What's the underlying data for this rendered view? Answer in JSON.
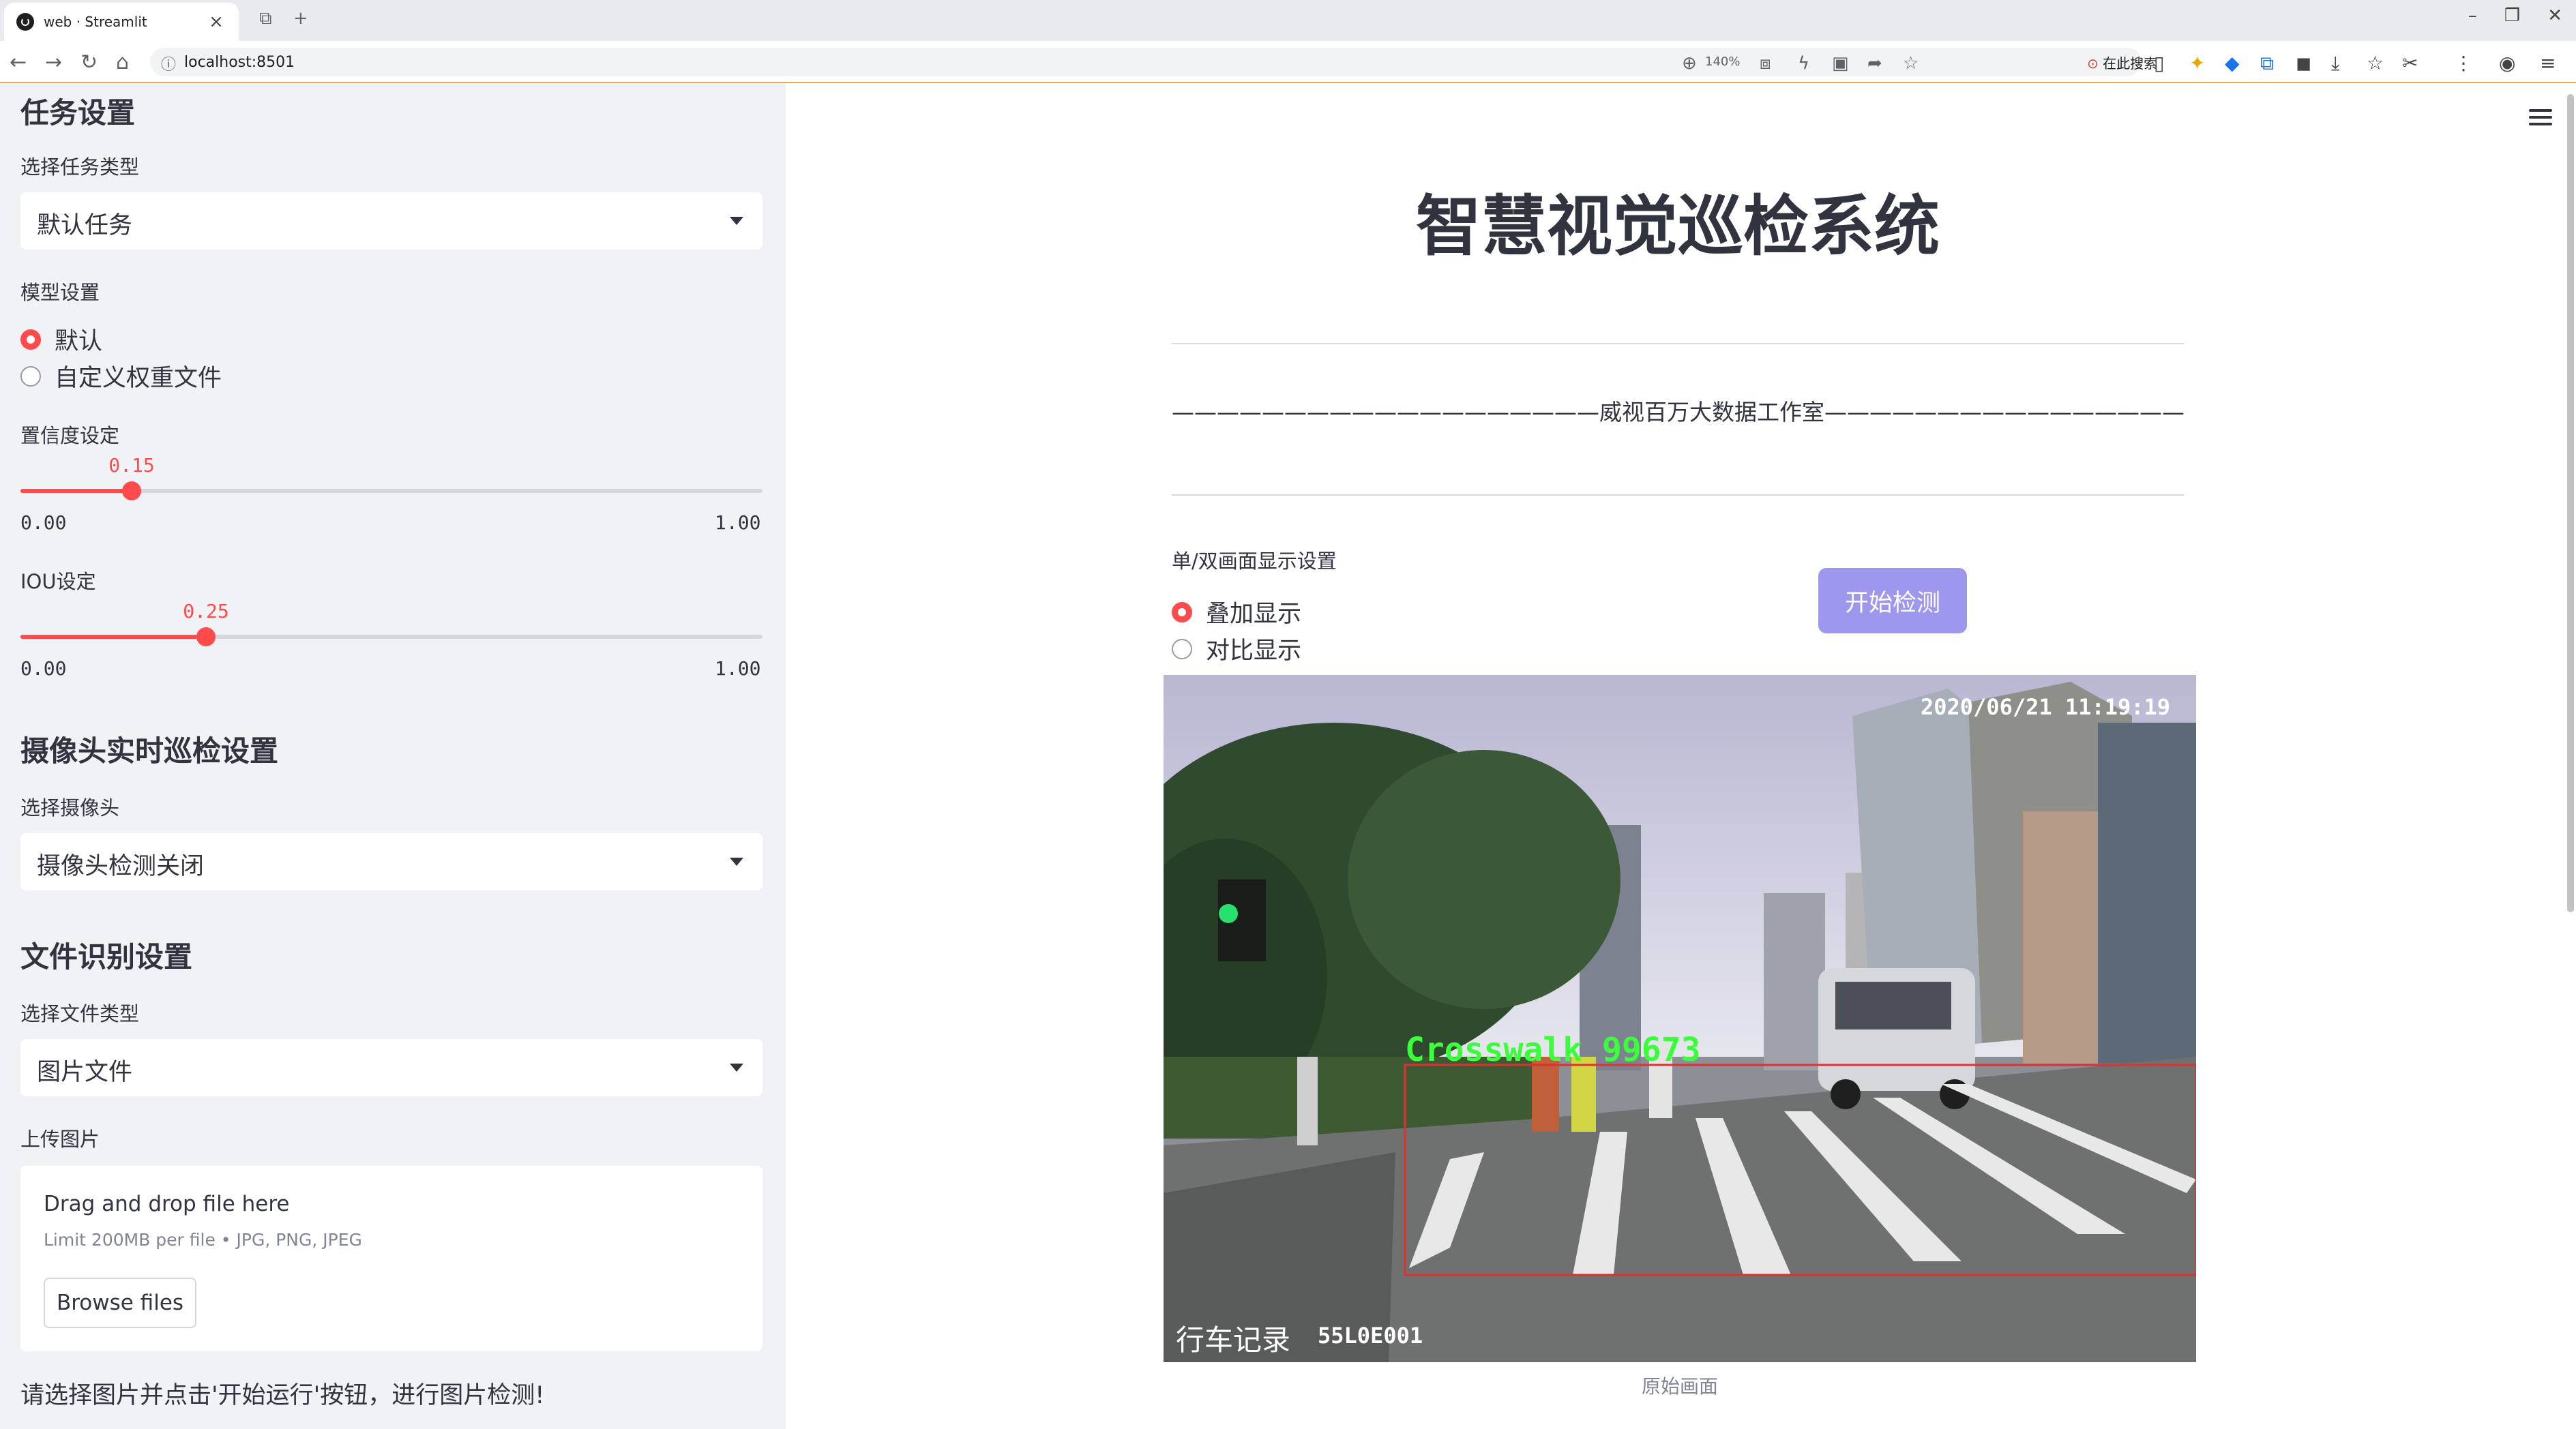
{
  "browser": {
    "tab_title": "web · Streamlit",
    "url": "localhost:8501",
    "zoom": "140%",
    "search_placeholder": "在此搜索"
  },
  "sidebar": {
    "task_section": {
      "heading": "任务设置",
      "task_type_label": "选择任务类型",
      "task_type_value": "默认任务"
    },
    "model_section": {
      "label": "模型设置",
      "options": [
        "默认",
        "自定义权重文件"
      ],
      "selected": "默认"
    },
    "confidence": {
      "label": "置信度设定",
      "value": "0.15",
      "min": "0.00",
      "max": "1.00",
      "fraction": 0.15
    },
    "iou": {
      "label": "IOU设定",
      "value": "0.25",
      "min": "0.00",
      "max": "1.00",
      "fraction": 0.25
    },
    "camera_section": {
      "heading": "摄像头实时巡检设置",
      "label": "选择摄像头",
      "value": "摄像头检测关闭"
    },
    "file_section": {
      "heading": "文件识别设置",
      "file_type_label": "选择文件类型",
      "file_type_value": "图片文件",
      "upload_label": "上传图片",
      "drop_text": "Drag and drop file here",
      "limit_text": "Limit 200MB per file • JPG, PNG, JPEG",
      "browse_label": "Browse files"
    },
    "hint": "请选择图片并点击'开始运行'按钮，进行图片检测!"
  },
  "main": {
    "title": "智慧视觉巡检系统",
    "studio_line": "———————————————————威视百万大数据工作室————————————————————",
    "display_label": "单/双画面显示设置",
    "display_options": [
      "叠加显示",
      "对比显示"
    ],
    "display_selected": "叠加显示",
    "start_button": "开始检测",
    "image": {
      "timestamp": "2020/06/21 11:19:19",
      "recorder_label": "行车记录",
      "plate_code": "55L0E001",
      "detection_label": "Crosswalk 99673",
      "caption": "原始画面"
    }
  },
  "colors": {
    "accent": "#ff4b4b",
    "sidebar_bg": "#f0f2f6",
    "start_button": "#9e97ee",
    "detection_text": "#3cff3c",
    "detection_box": "#e03030"
  }
}
